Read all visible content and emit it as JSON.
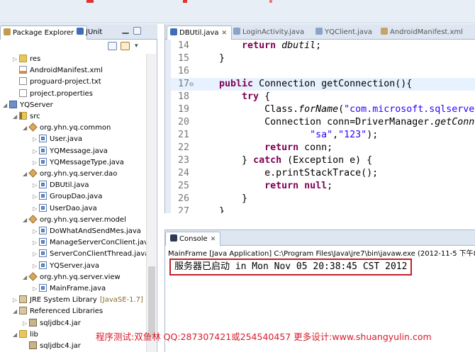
{
  "explorer": {
    "tabs": [
      {
        "label": "Package Explorer",
        "close": "✕"
      },
      {
        "label": "JUnit"
      }
    ],
    "tree": [
      {
        "label": "res",
        "indent": 1,
        "icon": "folder-icon",
        "twisty": "▷"
      },
      {
        "label": "AndroidManifest.xml",
        "indent": 1,
        "icon": "xml-file-icon",
        "twisty": ""
      },
      {
        "label": "proguard-project.txt",
        "indent": 1,
        "icon": "text-file-icon",
        "twisty": ""
      },
      {
        "label": "project.properties",
        "indent": 1,
        "icon": "text-file-icon",
        "twisty": ""
      },
      {
        "label": "YQServer",
        "indent": 0,
        "icon": "project-icon",
        "twisty": "◢"
      },
      {
        "label": "src",
        "indent": 1,
        "icon": "source-folder-icon",
        "twisty": "◢"
      },
      {
        "label": "org.yhn.yq.common",
        "indent": 2,
        "icon": "package-icon",
        "twisty": "◢"
      },
      {
        "label": "User.java",
        "indent": 3,
        "icon": "java-file-icon",
        "twisty": "▷"
      },
      {
        "label": "YQMessage.java",
        "indent": 3,
        "icon": "java-file-icon",
        "twisty": "▷"
      },
      {
        "label": "YQMessageType.java",
        "indent": 3,
        "icon": "java-file-icon",
        "twisty": "▷"
      },
      {
        "label": "org.yhn.yq.server.dao",
        "indent": 2,
        "icon": "package-icon",
        "twisty": "◢"
      },
      {
        "label": "DBUtil.java",
        "indent": 3,
        "icon": "java-file-icon",
        "twisty": "▷"
      },
      {
        "label": "GroupDao.java",
        "indent": 3,
        "icon": "java-file-icon",
        "twisty": "▷"
      },
      {
        "label": "UserDao.java",
        "indent": 3,
        "icon": "java-file-icon",
        "twisty": "▷"
      },
      {
        "label": "org.yhn.yq.server.model",
        "indent": 2,
        "icon": "package-icon",
        "twisty": "◢"
      },
      {
        "label": "DoWhatAndSendMes.java",
        "indent": 3,
        "icon": "java-file-icon",
        "twisty": "▷"
      },
      {
        "label": "ManageServerConClient.java",
        "indent": 3,
        "icon": "java-file-icon",
        "twisty": "▷"
      },
      {
        "label": "ServerConClientThread.java",
        "indent": 3,
        "icon": "java-file-icon",
        "twisty": "▷"
      },
      {
        "label": "YQServer.java",
        "indent": 3,
        "icon": "java-file-icon",
        "twisty": "▷"
      },
      {
        "label": "org.yhn.yq.server.view",
        "indent": 2,
        "icon": "package-icon",
        "twisty": "◢"
      },
      {
        "label": "MainFrame.java",
        "indent": 3,
        "icon": "java-file-icon",
        "twisty": "▷"
      },
      {
        "label": "JRE System Library",
        "extra": "[JavaSE-1.7]",
        "indent": 1,
        "icon": "library-icon",
        "twisty": "▷"
      },
      {
        "label": "Referenced Libraries",
        "indent": 1,
        "icon": "library-icon",
        "twisty": "◢"
      },
      {
        "label": "sqljdbc4.jar",
        "indent": 2,
        "icon": "jar-icon",
        "twisty": "▷"
      },
      {
        "label": "lib",
        "indent": 1,
        "icon": "folder-icon",
        "twisty": "◢"
      },
      {
        "label": "sqljdbc4.jar",
        "indent": 2,
        "icon": "jar-icon",
        "twisty": ""
      }
    ]
  },
  "editor": {
    "tabs": [
      {
        "label": "DBUtil.java",
        "close": "✕",
        "active": true
      },
      {
        "label": "LoginActivity.java",
        "active": false
      },
      {
        "label": "YQClient.java",
        "active": false
      },
      {
        "label": "AndroidManifest.xml",
        "active": false
      }
    ],
    "lines": [
      {
        "n": "14",
        "fold": "",
        "segs": [
          [
            "",
            "        "
          ],
          [
            "kw",
            "return"
          ],
          [
            "",
            " "
          ],
          [
            "it",
            "dbutil"
          ],
          [
            "",
            ";"
          ]
        ]
      },
      {
        "n": "15",
        "fold": "",
        "segs": [
          [
            "",
            "    }"
          ]
        ]
      },
      {
        "n": "16",
        "fold": "",
        "segs": [
          [
            "",
            ""
          ]
        ]
      },
      {
        "n": "17",
        "fold": "⊖",
        "cur": true,
        "segs": [
          [
            "",
            "    "
          ],
          [
            "kw",
            "public"
          ],
          [
            "",
            " Connection getConnection(){"
          ]
        ]
      },
      {
        "n": "18",
        "fold": "",
        "segs": [
          [
            "",
            "        "
          ],
          [
            "kw",
            "try"
          ],
          [
            "",
            " {"
          ]
        ]
      },
      {
        "n": "19",
        "fold": "",
        "segs": [
          [
            "",
            "            Class."
          ],
          [
            "it",
            "forName"
          ],
          [
            "",
            "("
          ],
          [
            "str",
            "\"com.microsoft.sqlserve"
          ]
        ]
      },
      {
        "n": "20",
        "fold": "",
        "segs": [
          [
            "",
            "            Connection conn=DriverManager."
          ],
          [
            "it",
            "getConn"
          ]
        ]
      },
      {
        "n": "21",
        "fold": "",
        "segs": [
          [
            "",
            "                    "
          ],
          [
            "str",
            "\"sa\""
          ],
          [
            "",
            ","
          ],
          [
            "str",
            "\"123\""
          ],
          [
            "",
            ");"
          ]
        ]
      },
      {
        "n": "22",
        "fold": "",
        "segs": [
          [
            "",
            "            "
          ],
          [
            "kw",
            "return"
          ],
          [
            "",
            " conn;"
          ]
        ]
      },
      {
        "n": "23",
        "fold": "",
        "segs": [
          [
            "",
            "        } "
          ],
          [
            "kw",
            "catch"
          ],
          [
            "",
            " (Exception e) {"
          ]
        ]
      },
      {
        "n": "24",
        "fold": "",
        "segs": [
          [
            "",
            "            e.printStackTrace();"
          ]
        ]
      },
      {
        "n": "25",
        "fold": "",
        "segs": [
          [
            "",
            "            "
          ],
          [
            "kw",
            "return"
          ],
          [
            "",
            " "
          ],
          [
            "kw",
            "null"
          ],
          [
            "",
            ";"
          ]
        ]
      },
      {
        "n": "26",
        "fold": "",
        "segs": [
          [
            "",
            "        }"
          ]
        ]
      },
      {
        "n": "27",
        "fold": "",
        "segs": [
          [
            "",
            "    }"
          ]
        ]
      }
    ]
  },
  "console": {
    "tab_label": "Console",
    "close": "✕",
    "description": "MainFrame [Java Application] C:\\Program Files\\Java\\jre7\\bin\\javaw.exe (2012-11-5 下午8:38:",
    "output": "服务器已启动 in Mon Nov 05 20:38:45 CST 2012"
  },
  "watermark": "程序测试:双鱼林 QQ:287307421或254540457 更多设计:www.shuangyulin.com"
}
